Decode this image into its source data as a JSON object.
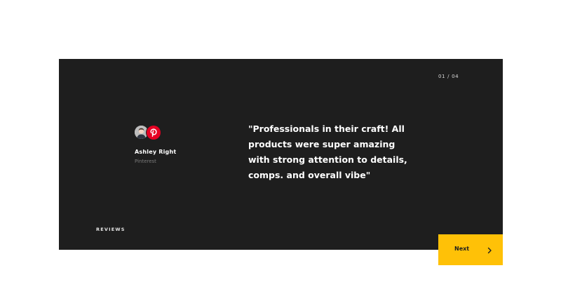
{
  "testimonial": {
    "counter": {
      "current": "01",
      "separator": "/",
      "total": "04"
    },
    "quote": "\"Professionals in their craft! All products were super amazing with strong attention to details, comps. and overall vibe\"",
    "author": {
      "name": "Ashley Right",
      "company": "Pinterest",
      "avatar_icon": "user-avatar",
      "brand_icon": "pinterest-icon"
    },
    "section_label": "REVIEWS"
  },
  "navigation": {
    "next_label": "Next",
    "next_icon": "chevron-right-icon"
  },
  "colors": {
    "card_background": "#1e1e1e",
    "accent": "#ffc107",
    "brand_red": "#e60023",
    "page_background": "#ffffff"
  }
}
